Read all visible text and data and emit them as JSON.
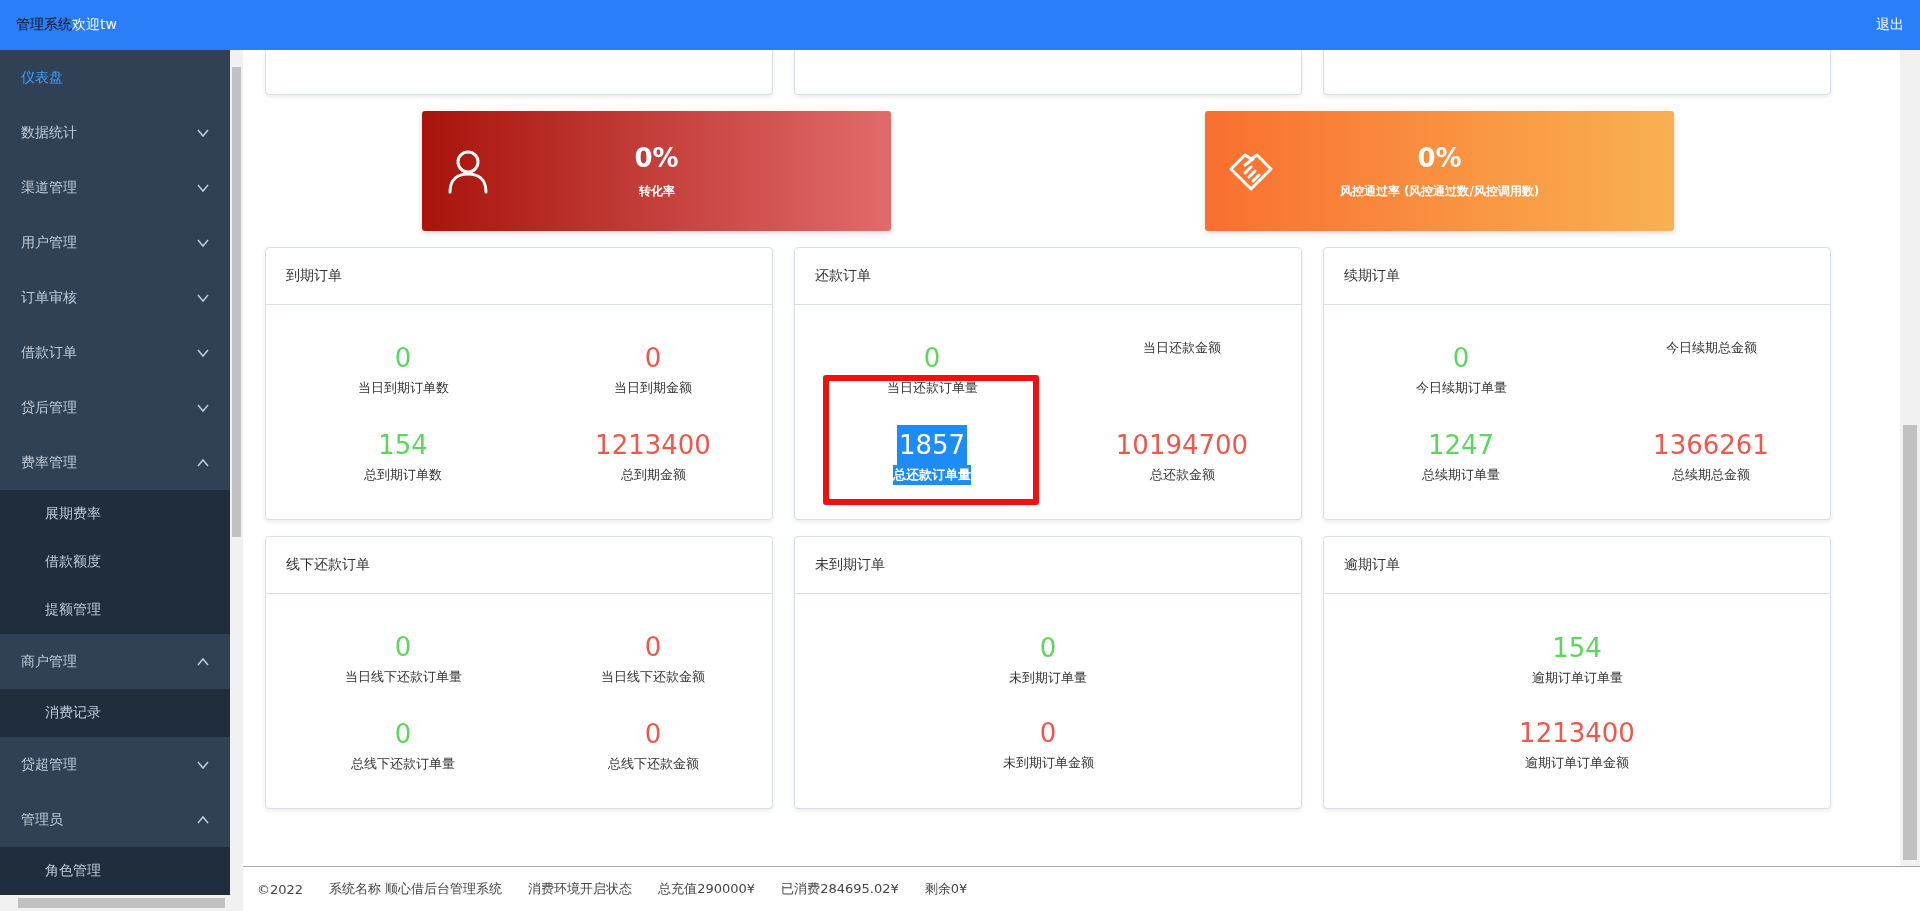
{
  "header": {
    "brand": "管理系统",
    "greeting": "欢迎tw",
    "logout": "退出"
  },
  "sidebar": {
    "items": [
      {
        "label": "仪表盘",
        "kind": "link",
        "selected": true
      },
      {
        "label": "数据统计",
        "kind": "group",
        "expanded": false,
        "selected": false
      },
      {
        "label": "渠道管理",
        "kind": "group",
        "expanded": false,
        "selected": false
      },
      {
        "label": "用户管理",
        "kind": "group",
        "expanded": false,
        "selected": false
      },
      {
        "label": "订单审核",
        "kind": "group",
        "expanded": false,
        "selected": false
      },
      {
        "label": "借款订单",
        "kind": "group",
        "expanded": false,
        "selected": false
      },
      {
        "label": "贷后管理",
        "kind": "group",
        "expanded": false,
        "selected": false
      },
      {
        "label": "费率管理",
        "kind": "group",
        "expanded": true,
        "selected": false,
        "children": [
          {
            "label": "展期费率",
            "selected": false
          },
          {
            "label": "借款额度",
            "selected": false
          },
          {
            "label": "提额管理",
            "selected": false
          }
        ]
      },
      {
        "label": "商户管理",
        "kind": "group",
        "expanded": true,
        "selected": false,
        "children": [
          {
            "label": "消费记录",
            "selected": false
          }
        ]
      },
      {
        "label": "贷超管理",
        "kind": "group",
        "expanded": false,
        "selected": false
      },
      {
        "label": "管理员",
        "kind": "group",
        "expanded": true,
        "selected": false,
        "children": [
          {
            "label": "角色管理",
            "selected": false
          }
        ]
      }
    ]
  },
  "rate_cards": [
    {
      "kind": "user",
      "value": "0%",
      "label": "转化率"
    },
    {
      "kind": "handshake",
      "value": "0%",
      "label": "风控通过率 (风控通过数/风控调用数)"
    }
  ],
  "order_cards": [
    {
      "title": "到期订单",
      "kind": "grid",
      "stats": [
        {
          "value": "0",
          "label": "当日到期订单数",
          "color": "#5cd65c",
          "highlighted": false
        },
        {
          "value": "0",
          "label": "当日到期金额",
          "color": "#f0564a",
          "highlighted": false
        },
        {
          "value": "154",
          "label": "总到期订单数",
          "color": "#5cd65c",
          "highlighted": false
        },
        {
          "value": "1213400",
          "label": "总到期金额",
          "color": "#f0564a",
          "highlighted": false
        }
      ]
    },
    {
      "title": "还款订单",
      "kind": "grid",
      "annotated": true,
      "stats": [
        {
          "value": "0",
          "label": "当日还款订单量",
          "color": "#5cd65c",
          "highlighted": false
        },
        {
          "label": "当日还款金额",
          "highlighted": false
        },
        {
          "value": "1857",
          "label": "总还款订单量",
          "highlighted": true
        },
        {
          "value": "10194700",
          "label": "总还款金额",
          "color": "#f0564a",
          "highlighted": false
        }
      ]
    },
    {
      "title": "续期订单",
      "kind": "grid",
      "stats": [
        {
          "value": "0",
          "label": "今日续期订单量",
          "color": "#5cd65c",
          "highlighted": false
        },
        {
          "label": "今日续期总金额",
          "highlighted": false
        },
        {
          "value": "1247",
          "label": "总续期订单量",
          "color": "#5cd65c",
          "highlighted": false
        },
        {
          "value": "1366261",
          "label": "总续期总金额",
          "color": "#f0564a",
          "highlighted": false
        }
      ]
    },
    {
      "title": "线下还款订单",
      "kind": "grid",
      "stats": [
        {
          "value": "0",
          "label": "当日线下还款订单量",
          "color": "#5cd65c",
          "highlighted": false
        },
        {
          "value": "0",
          "label": "当日线下还款金额",
          "color": "#f0564a",
          "highlighted": false
        },
        {
          "value": "0",
          "label": "总线下还款订单量",
          "color": "#5cd65c",
          "highlighted": false
        },
        {
          "value": "0",
          "label": "总线下还款金额",
          "color": "#f0564a",
          "highlighted": false
        }
      ]
    },
    {
      "title": "未到期订单",
      "kind": "column",
      "stats": [
        {
          "value": "0",
          "label": "未到期订单量",
          "color": "#5cd65c",
          "highlighted": false
        },
        {
          "value": "0",
          "label": "未到期订单金额",
          "color": "#f0564a",
          "highlighted": false
        }
      ]
    },
    {
      "title": "逾期订单",
      "kind": "column",
      "stats": [
        {
          "value": "154",
          "label": "逾期订单订单量",
          "color": "#5cd65c",
          "highlighted": false
        },
        {
          "value": "1213400",
          "label": "逾期订单订单金额",
          "color": "#f0564a",
          "highlighted": false
        }
      ]
    }
  ],
  "footer": [
    "©2022",
    "系统名称 顺心借后台管理系统",
    "消费环境开启状态",
    "总充值290000¥",
    "已消费284695.02¥",
    "剩余0¥"
  ]
}
